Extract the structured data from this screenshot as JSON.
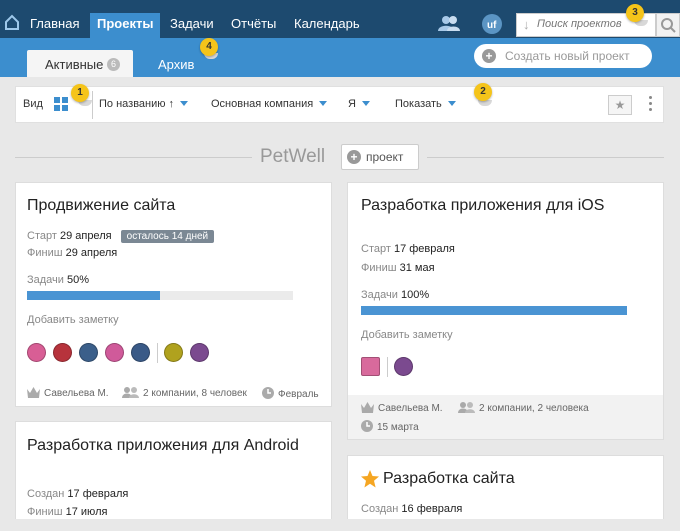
{
  "topnav": {
    "items": [
      "Главная",
      "Проекты",
      "Задачи",
      "Отчёты",
      "Календарь"
    ],
    "search_placeholder": "Поиск проектов",
    "colors": {
      "bar": "#1d4a6f",
      "active": "#3c8ece"
    }
  },
  "subtabs": {
    "active_label": "Активные",
    "active_count": "6",
    "archive_label": "Архив",
    "create_label": "Создать новый проект"
  },
  "filters": {
    "view_label": "Вид",
    "sort_label": "По названию ↑",
    "company_label": "Основная компания",
    "owner_label": "Я",
    "show_label": "Показать",
    "star_glyph": "★"
  },
  "markers": [
    "1",
    "2",
    "3",
    "4"
  ],
  "group": {
    "title": "PetWell",
    "add_label": "проект"
  },
  "cards": [
    {
      "title": "Продвижение сайта",
      "start_label": "Старт",
      "start_value": "29 апреля",
      "badge": "осталось 14 дней",
      "finish_label": "Финиш",
      "finish_value": "29 апреля",
      "tasks_label": "Задачи",
      "tasks_value": "50%",
      "progress": 0.5,
      "note_label": "Добавить заметку",
      "owner": "Савельева М.",
      "team": "2 компании, 8 человек",
      "date": "Февраль"
    },
    {
      "title": "Разработка приложения для iOS",
      "start_label": "Старт",
      "start_value": "17 февраля",
      "finish_label": "Финиш",
      "finish_value": "31 мая",
      "tasks_label": "Задачи",
      "tasks_value": "100%",
      "progress": 1.0,
      "note_label": "Добавить заметку",
      "owner": "Савельева М.",
      "team": "2 компании, 2 человека",
      "date": "15 марта"
    },
    {
      "title": "Разработка приложения для Android",
      "created_label": "Создан",
      "created_value": "17 февраля",
      "finish_label": "Финиш",
      "finish_value": "17 июля"
    },
    {
      "title": "Разработка сайта",
      "starred": true,
      "created_label": "Создан",
      "created_value": "16 февраля"
    }
  ]
}
